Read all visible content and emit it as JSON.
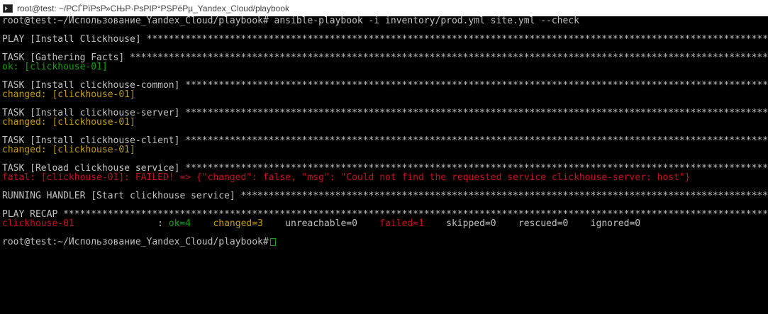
{
  "window": {
    "title": "root@test: ~/РСЃРїРѕР»СЊР·РѕРІР°РЅРёРµ_Yandex_Cloud/playbook",
    "icon": "terminal-icon"
  },
  "terminal": {
    "prompt": "root@test:~/Использование_Yandex_Cloud/playbook#",
    "command": " ansible-playbook -i inventory/prod.yml site.yml --check",
    "play_header": "PLAY [Install Clickhouse] *******************************************************************************************************************",
    "tasks": [
      {
        "header": "TASK [Gathering Facts] **********************************************************************************************************************",
        "result": "ok: [clickhouse-01]",
        "status": "ok"
      },
      {
        "header": "TASK [Install clickhouse-common] ************************************************************************************************************",
        "result": "changed: [clickhouse-01]",
        "status": "changed"
      },
      {
        "header": "TASK [Install clickhouse-server] ************************************************************************************************************",
        "result": "changed: [clickhouse-01]",
        "status": "changed"
      },
      {
        "header": "TASK [Install clickhouse-client] ************************************************************************************************************",
        "result": "changed: [clickhouse-01]",
        "status": "changed"
      },
      {
        "header": "TASK [Reload clickhouse service] ************************************************************************************************************",
        "result": "fatal: [clickhouse-01]: FAILED! => {\"changed\": false, \"msg\": \"Could not find the requested service clickhouse-server: host\"}",
        "status": "fatal"
      }
    ],
    "handler_header": "RUNNING HANDLER [Start clickhouse service] **************************************************************************************************",
    "recap_header": "PLAY RECAP **********************************************************************************************************************************",
    "recap": {
      "host": "clickhouse-01              ",
      "sep": " : ",
      "ok": "ok=4    ",
      "changed": "changed=3   ",
      "unreachable": " unreachable=0    ",
      "failed": "failed=1    ",
      "rest": "skipped=0    rescued=0    ignored=0"
    },
    "final_prompt": "root@test:~/Использование_Yandex_Cloud/playbook#"
  },
  "colors": {
    "ok": "#13a10e",
    "changed": "#c19c00",
    "fatal": "#c50f1f",
    "default": "#c0c0c0",
    "background": "#000000"
  }
}
